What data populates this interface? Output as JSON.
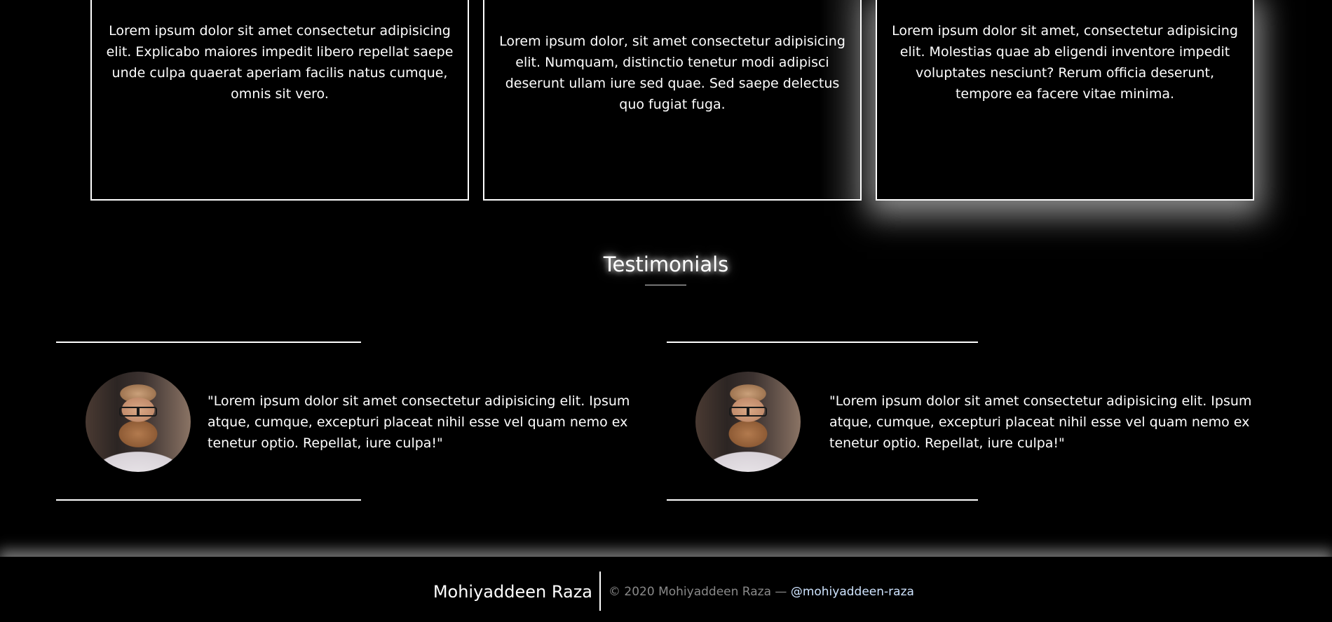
{
  "cards": [
    {
      "text": "Lorem ipsum dolor sit amet consectetur adipisicing elit. Explicabo maiores impedit libero repellat saepe unde culpa quaerat aperiam facilis natus cumque, omnis sit vero."
    },
    {
      "text": "Lorem ipsum dolor, sit amet consectetur adipisicing elit. Numquam, distinctio tenetur modi adipisci deserunt ullam iure sed quae. Sed saepe delectus quo fugiat fuga."
    },
    {
      "text": "Lorem ipsum dolor sit amet, consectetur adipisicing elit. Molestias quae ab eligendi inventore impedit voluptates nesciunt? Rerum officia deserunt, tempore ea facere vitae minima."
    }
  ],
  "testimonials": {
    "title": "Testimonials",
    "items": [
      {
        "quote": "\"Lorem ipsum dolor sit amet consectetur adipisicing elit. Ipsum atque, cumque, excepturi placeat nihil esse vel quam nemo ex tenetur optio. Repellat, iure culpa!\""
      },
      {
        "quote": "\"Lorem ipsum dolor sit amet consectetur adipisicing elit. Ipsum atque, cumque, excepturi placeat nihil esse vel quam nemo ex tenetur optio. Repellat, iure culpa!\""
      }
    ]
  },
  "footer": {
    "name": "Mohiyaddeen Raza",
    "copyright": "© 2020 Mohiyaddeen Raza —",
    "handle": "@mohiyaddeen-raza"
  }
}
